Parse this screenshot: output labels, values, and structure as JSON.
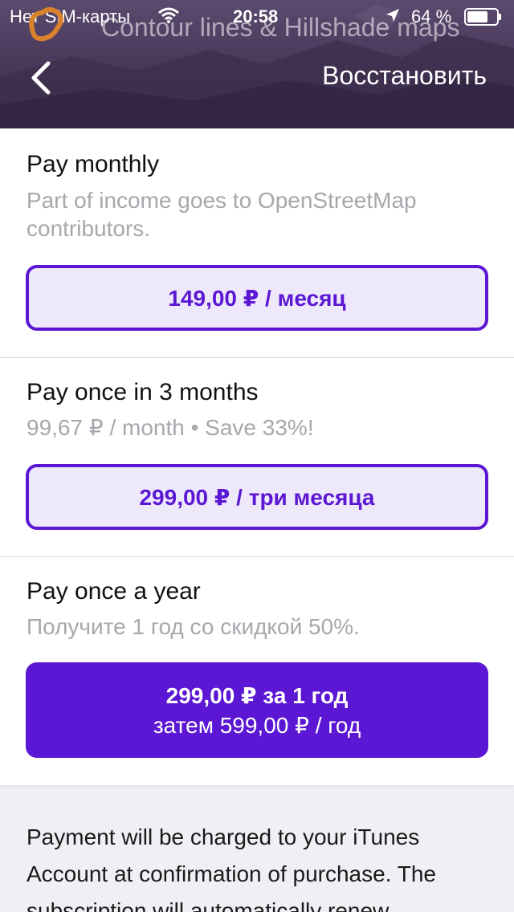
{
  "status_bar": {
    "carrier": "Нет SIM-карты",
    "time": "20:58",
    "battery": "64 %"
  },
  "header": {
    "title": "Contour lines & Hillshade maps",
    "restore_label": "Восстановить",
    "back_icon": "chevron-left-icon"
  },
  "plans": [
    {
      "title": "Pay monthly",
      "description": "Part of income goes to OpenStreetMap contributors.",
      "button_label": "149,00 ₽ / месяц"
    },
    {
      "title": "Pay once in 3 months",
      "description": "99,67 ₽ / month • Save 33%!",
      "button_label": "299,00 ₽ / три месяца"
    },
    {
      "title": "Pay once a year",
      "description": "Получите 1 год со скидкой 50%.",
      "button_label": "299,00 ₽ за 1 год",
      "button_sublabel": "затем 599,00 ₽ / год"
    }
  ],
  "footer": {
    "text": "Payment will be charged to your iTunes Account at confirmation of purchase. The subscription will automatically renew"
  },
  "colors": {
    "accent": "#5b17d4",
    "accent_light": "#eee8fb",
    "muted_text": "#a7a7ad",
    "header_bg": "#4a3a5c"
  }
}
